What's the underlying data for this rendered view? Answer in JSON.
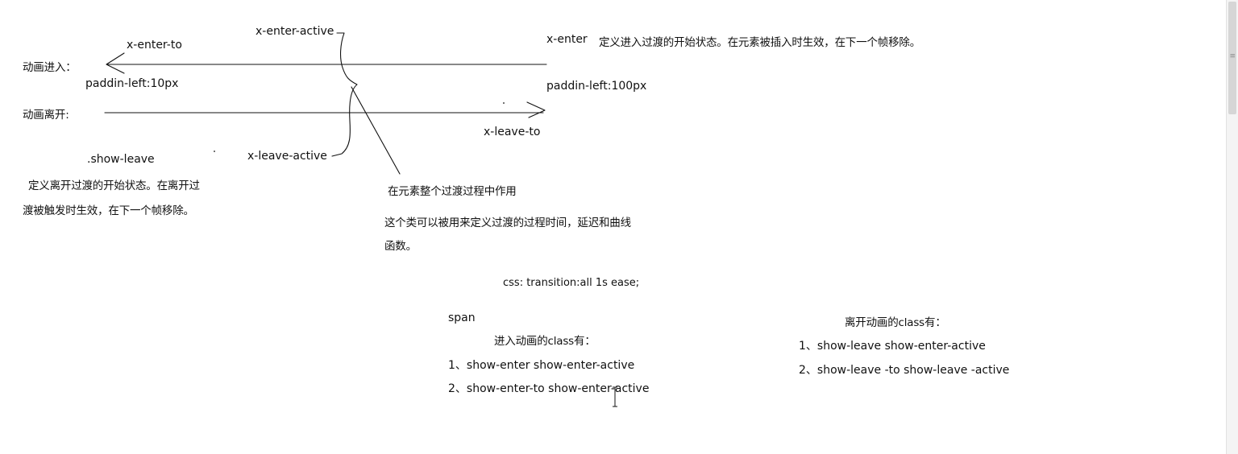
{
  "labels": {
    "x_enter_to": "x-enter-to",
    "x_enter_active": "x-enter-active",
    "x_enter": "x-enter",
    "x_enter_desc": "定义进入过渡的开始状态。在元素被插入时生效，在下一个帧移除。",
    "enter_row": "动画进入：",
    "padding_left_10": "paddin-left:10px",
    "padding_left_100": "paddin-left:100px",
    "leave_row": "动画离开:",
    "x_leave_to": "x-leave-to",
    "show_leave": ".show-leave",
    "x_leave_active": "x-leave-active",
    "leave_desc_line1": "定义离开过渡的开始状态。在离开过",
    "leave_desc_line2": "渡被触发时生效，在下一个帧移除。",
    "active_desc": "在元素整个过渡过程中作用",
    "class_usage_line1": "这个类可以被用来定义过渡的过程时间，延迟和曲线",
    "class_usage_line2": "函数。",
    "css_transition": "css: transition:all 1s ease;",
    "span_text": "span",
    "enter_classes_title": "进入动画的class有：",
    "enter_class_1": "1、show-enter show-enter-active",
    "enter_class_2": "2、show-enter-to show-enter-active",
    "leave_classes_title": "离开动画的class有：",
    "leave_class_1": "1、show-leave show-enter-active",
    "leave_class_2": "2、show-leave -to show-leave -active"
  },
  "colors": {
    "ink": "#111111",
    "background": "#ffffff"
  },
  "icons": {
    "scrollbar_grip": "≡"
  }
}
